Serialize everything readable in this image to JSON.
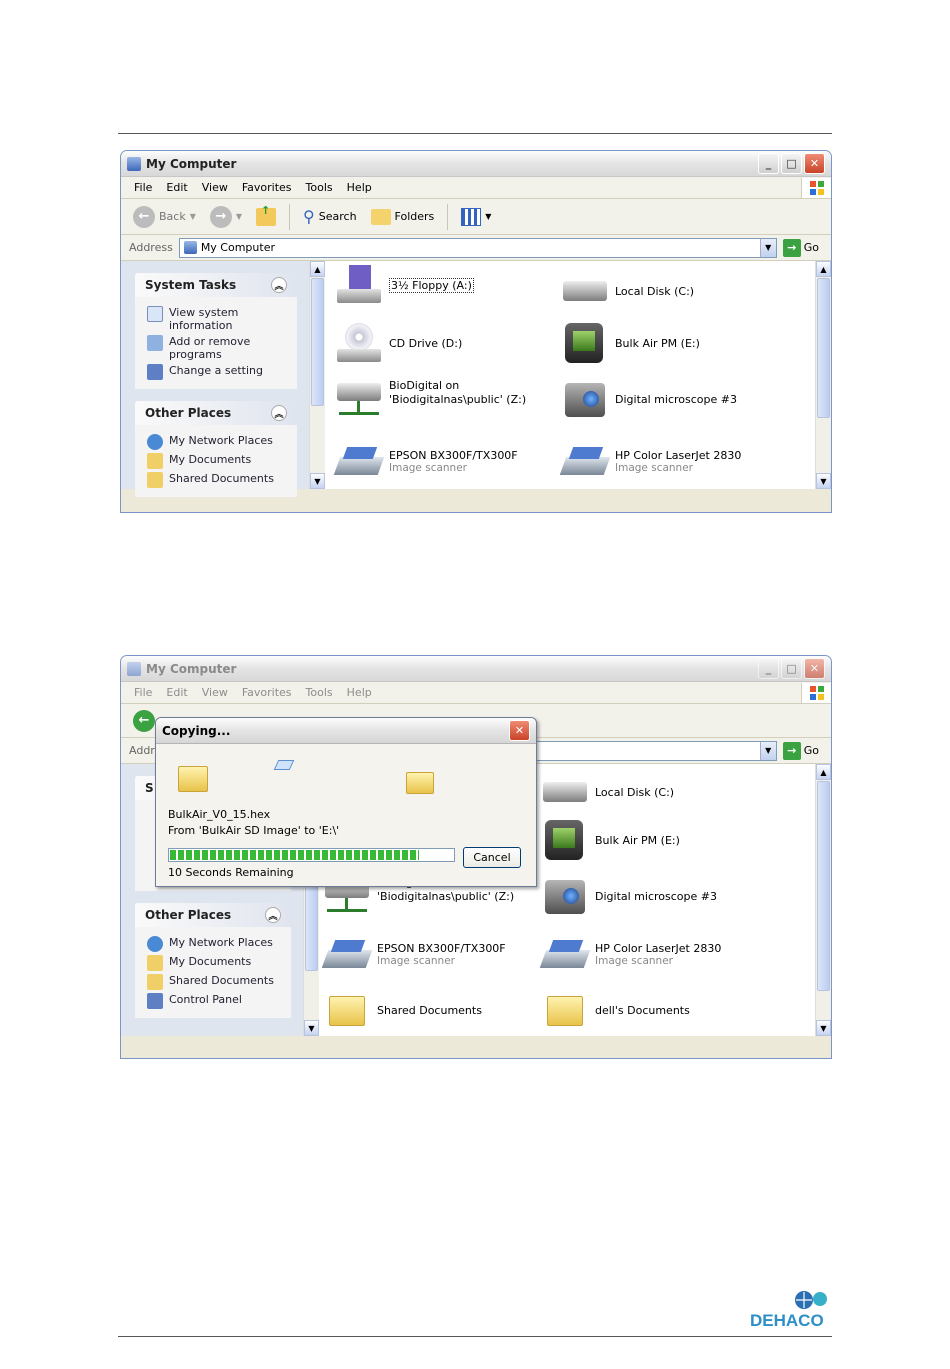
{
  "window1": {
    "title": "My Computer",
    "menu": [
      "File",
      "Edit",
      "View",
      "Favorites",
      "Tools",
      "Help"
    ],
    "toolbar": {
      "back": "Back",
      "search": "Search",
      "folders": "Folders"
    },
    "address": {
      "label": "Address",
      "value": "My Computer",
      "go": "Go"
    },
    "system_tasks": {
      "title": "System Tasks",
      "items": [
        "View system information",
        "Add or remove programs",
        "Change a setting"
      ]
    },
    "other_places": {
      "title": "Other Places",
      "items": [
        "My Network Places",
        "My Documents",
        "Shared Documents"
      ]
    },
    "items": [
      {
        "label": "3½ Floppy (A:)",
        "sub": ""
      },
      {
        "label": "Local Disk (C:)",
        "sub": ""
      },
      {
        "label": "CD Drive (D:)",
        "sub": ""
      },
      {
        "label": "Bulk Air PM (E:)",
        "sub": ""
      },
      {
        "label": "BioDigital on 'Biodigitalnas\\public' (Z:)",
        "sub": ""
      },
      {
        "label": "Digital microscope #3",
        "sub": ""
      },
      {
        "label": "EPSON BX300F/TX300F",
        "sub": "Image scanner"
      },
      {
        "label": "HP Color LaserJet 2830",
        "sub": "Image scanner"
      }
    ]
  },
  "window2": {
    "title": "My Computer",
    "menu": [
      "File",
      "Edit",
      "View",
      "Favorites",
      "Tools",
      "Help"
    ],
    "address": {
      "label": "Addr",
      "go": "Go"
    },
    "system_tasks_letter": "S",
    "other_places": {
      "title": "Other Places",
      "items": [
        "My Network Places",
        "My Documents",
        "Shared Documents",
        "Control Panel"
      ]
    },
    "items": [
      {
        "label": "Local Disk (C:)",
        "sub": ""
      },
      {
        "label": "Bulk Air PM (E:)",
        "sub": ""
      },
      {
        "label": "BioDigital on 'Biodigitalnas\\public' (Z:)",
        "sub": ""
      },
      {
        "label": "Digital microscope #3",
        "sub": ""
      },
      {
        "label": "EPSON BX300F/TX300F",
        "sub": "Image scanner"
      },
      {
        "label": "HP Color LaserJet 2830",
        "sub": "Image scanner"
      },
      {
        "label": "Shared Documents",
        "sub": ""
      },
      {
        "label": "dell's Documents",
        "sub": ""
      }
    ]
  },
  "copy_dialog": {
    "title": "Copying...",
    "file": "BulkAir_V0_15.hex",
    "from_to": "From 'BulkAir SD Image' to 'E:\\'",
    "progress": 0.88,
    "remaining": "10 Seconds Remaining",
    "cancel": "Cancel"
  },
  "logo_text": "DEHACO"
}
